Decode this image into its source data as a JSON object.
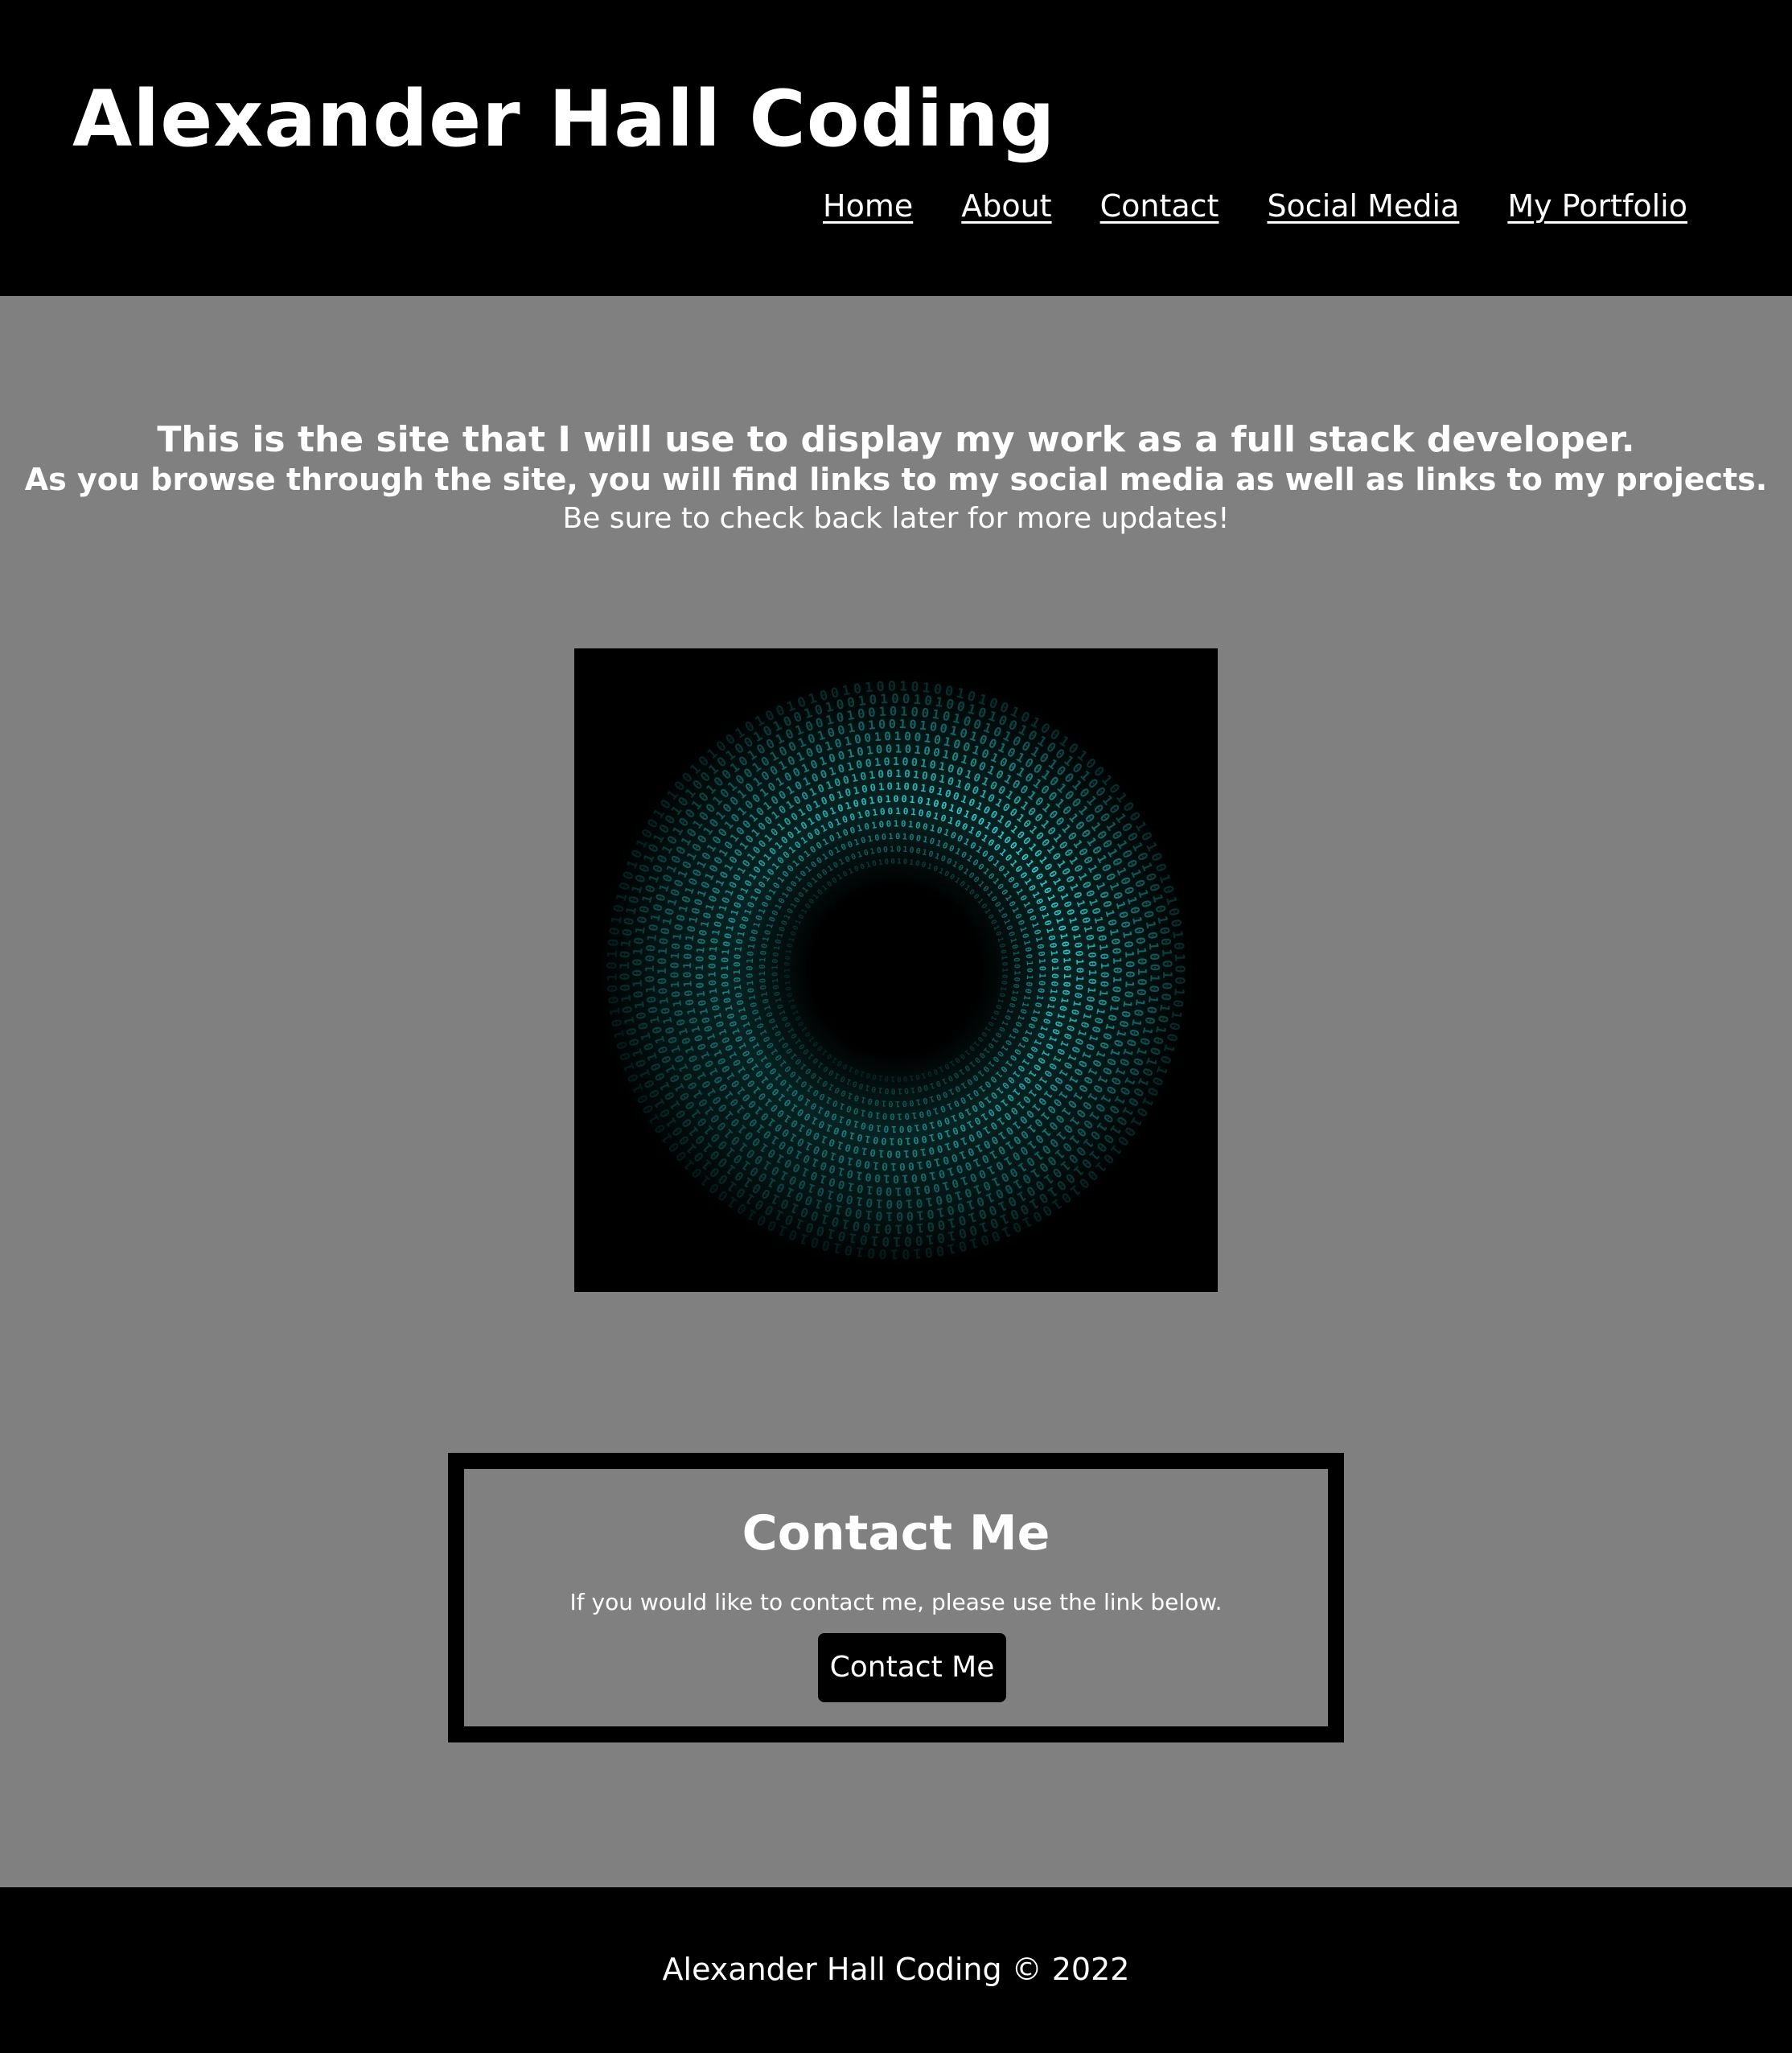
{
  "header": {
    "title": "Alexander Hall Coding",
    "nav": [
      {
        "label": "Home"
      },
      {
        "label": "About"
      },
      {
        "label": "Contact"
      },
      {
        "label": "Social Media"
      },
      {
        "label": "My Portfolio"
      }
    ]
  },
  "main": {
    "intro_line_1": "This is the site that I will use to display my work as a full stack developer.",
    "intro_line_2": "As you browse through the site, you will find links to my social media as well as links to my projects.",
    "intro_line_3": "Be sure to check back later for more updates!",
    "hero_image": {
      "description_icon": "binary-tunnel-image",
      "accent_color": "#35d6d6",
      "background_color": "#000000"
    }
  },
  "contact": {
    "title": "Contact Me",
    "text": "If you would like to contact me, please use the link below.",
    "button_label": "Contact Me"
  },
  "footer": {
    "text": "Alexander Hall Coding © 2022"
  },
  "colors": {
    "page_background": "#808080",
    "header_background": "#000000",
    "footer_background": "#000000",
    "text": "#ffffff"
  }
}
